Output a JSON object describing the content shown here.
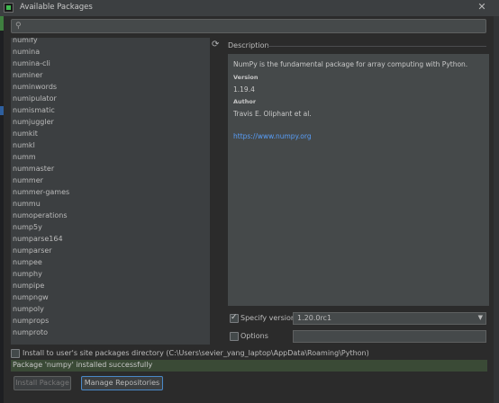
{
  "window": {
    "title": "Available Packages"
  },
  "search": {
    "value": "",
    "placeholder": ""
  },
  "packages": [
    "numify",
    "numina",
    "numina-cli",
    "numiner",
    "numinwords",
    "numipulator",
    "numismatic",
    "numjuggler",
    "numkit",
    "numkl",
    "numm",
    "nummaster",
    "nummer",
    "nummer-games",
    "nummu",
    "numoperations",
    "nump5y",
    "numparse164",
    "numparser",
    "numpee",
    "numphy",
    "numpipe",
    "numpngw",
    "numpoly",
    "numprops",
    "numproto"
  ],
  "description": {
    "section_label": "Description",
    "summary": "NumPy is the fundamental package for array computing with Python.",
    "version_heading": "Version",
    "version": "1.19.4",
    "author_heading": "Author",
    "author": "Travis E. Oliphant et al.",
    "homepage": "https://www.numpy.org"
  },
  "options": {
    "specify_version_label": "Specify version",
    "specify_version_checked": true,
    "selected_version": "1.20.0rc1",
    "options_label": "Options",
    "options_checked": false,
    "options_value": ""
  },
  "site_packages": {
    "label": "Install to user's site packages directory (C:\\Users\\sevier_yang_laptop\\AppData\\Roaming\\Python)",
    "checked": false
  },
  "status": {
    "message": "Package 'numpy' installed successfully"
  },
  "buttons": {
    "install": "Install Package",
    "manage": "Manage Repositories"
  },
  "colors": {
    "accent": "#589df6",
    "status_bg": "#3a4a36",
    "focus_border": "#4a88c7"
  },
  "icons": {
    "app": "pycharm-icon",
    "close": "close-icon",
    "search": "search-icon",
    "reload": "reload-icon",
    "dropdown": "chevron-down-icon"
  }
}
